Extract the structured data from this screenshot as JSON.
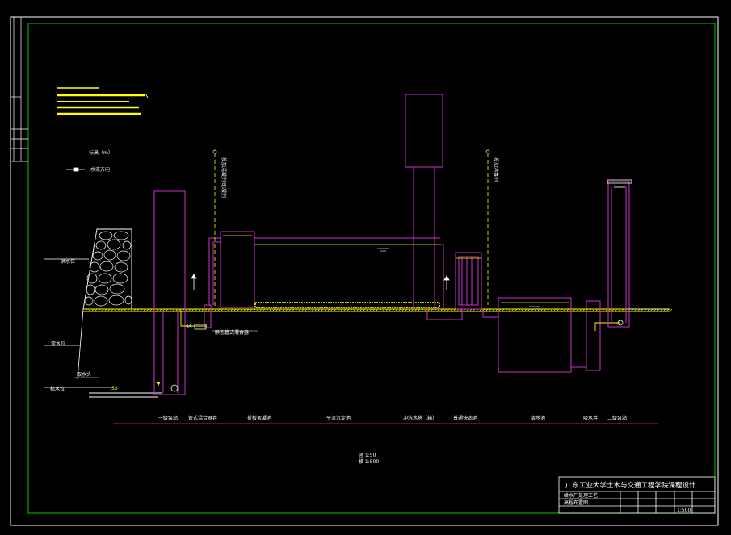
{
  "colors": {
    "background": "#000000",
    "border": "#ffffff",
    "inner_border": "#00c800",
    "structure": "#cc33cc",
    "water": "#ffff00",
    "text": "#ffffff",
    "ground": "#ffff00",
    "baseline": "#cc2222"
  },
  "legend": {
    "elevation_label": "标高（m）",
    "flow_direction_label": "水流方向"
  },
  "water_levels": {
    "flood": "洪水位",
    "normal": "常水位",
    "low": "枯水位"
  },
  "intake_label": "取水头",
  "dosing_labels": {
    "left": "投加混凝剂/助凝剂",
    "right": "投加消毒剂"
  },
  "mixer_label": "静态管式混合器",
  "stations": [
    "一级泵站",
    "管式混合器井",
    "折板絮凝池",
    "平流沉淀池",
    "冲洗水塔（箱）",
    "普通快滤池",
    "清水池",
    "吸水井",
    "二级泵站"
  ],
  "scale_text": {
    "line1": "竖  1:50",
    "line2": "横  1:500"
  },
  "title_block": {
    "school": "广东工业大学土木与交通工程学院课程设计",
    "drawing_name_1": "给水厂处理工艺",
    "drawing_name_2": "高程布置图",
    "scale_value": "1:500"
  }
}
